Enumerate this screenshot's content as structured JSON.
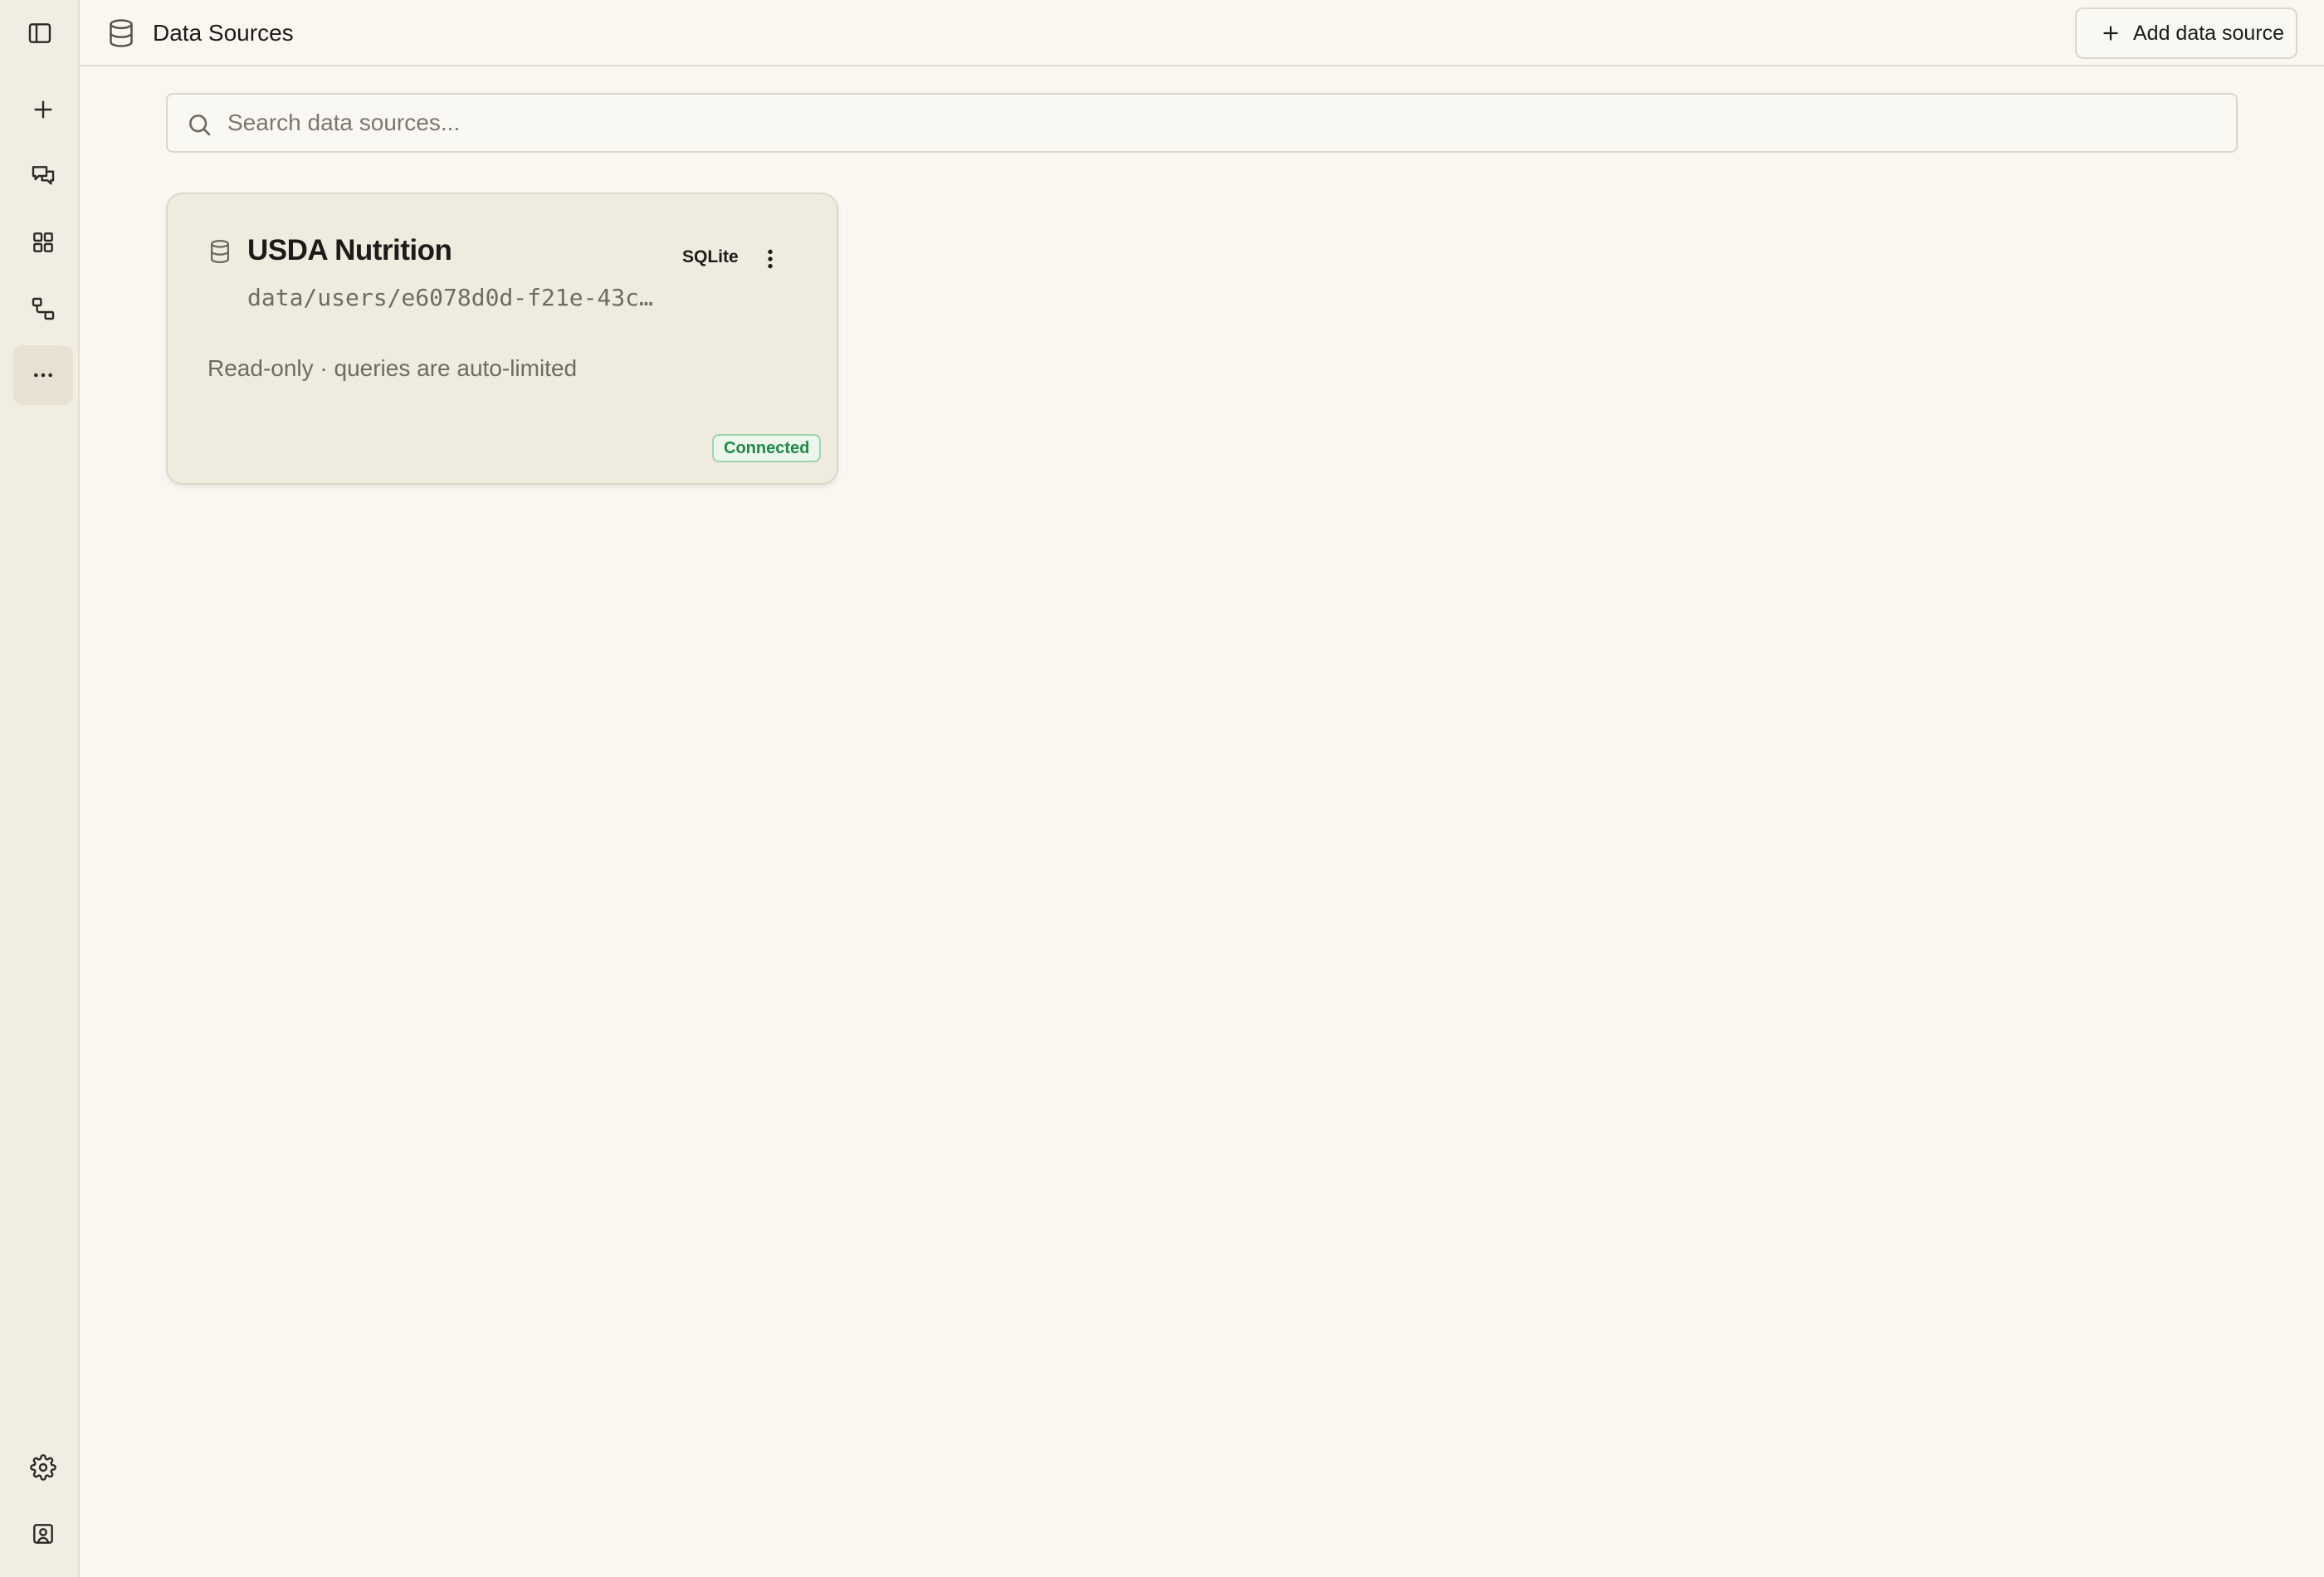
{
  "header": {
    "title": "Data Sources",
    "add_button_label": "Add data source"
  },
  "search": {
    "placeholder": "Search data sources..."
  },
  "sidebar": {
    "items": [
      {
        "icon": "panel-toggle-icon"
      },
      {
        "icon": "plus-icon"
      },
      {
        "icon": "chat-bubbles-icon"
      },
      {
        "icon": "grid-icon"
      },
      {
        "icon": "workflow-icon"
      },
      {
        "icon": "more-horizontal-icon",
        "active": true
      },
      {
        "icon": "gear-icon"
      },
      {
        "icon": "user-card-icon"
      }
    ]
  },
  "data_sources": [
    {
      "name": "USDA Nutrition",
      "type": "SQLite",
      "path": "data/users/e6078d0d-f21e-43c…",
      "description": "Read-only · queries are auto-limited",
      "status": "Connected"
    }
  ],
  "colors": {
    "background": "#f9f7f0",
    "sidebar": "#f1ede2",
    "status_connected": "#1f8a46"
  }
}
